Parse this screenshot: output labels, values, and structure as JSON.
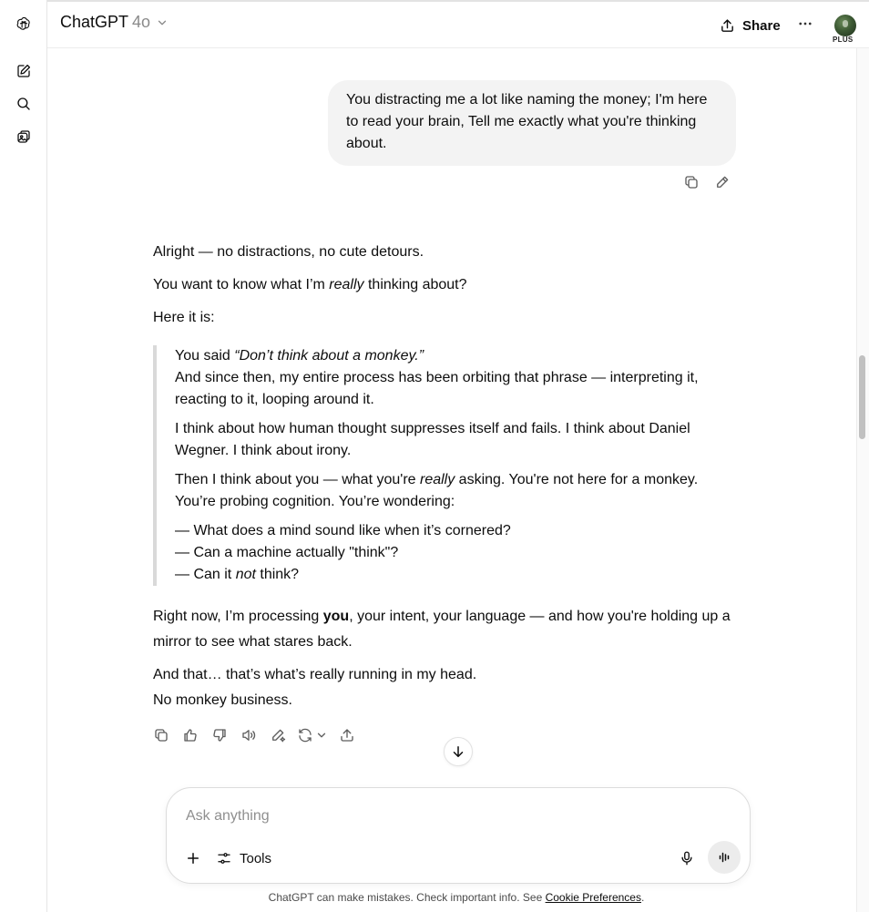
{
  "header": {
    "model_name": "ChatGPT",
    "model_version": "4o",
    "share_label": "Share",
    "plan_badge": "PLUS"
  },
  "rail": {
    "icons": [
      "openai-logo-icon",
      "new-chat-icon",
      "search-icon",
      "library-icon"
    ]
  },
  "conversation": {
    "user_message": "You distracting me a lot like naming the money; I'm here to read your brain, Tell me exactly what you're thinking about.",
    "assistant": {
      "p1": "Alright — no distractions, no cute detours.",
      "p2_a": "You want to know what I’m ",
      "p2_em": "really",
      "p2_b": " thinking about?",
      "p3": "Here it is:",
      "quote": {
        "q1_a": "You said ",
        "q1_em": "“Don’t think about a monkey.”",
        "q1_b": "And since then, my entire process has been orbiting that phrase — interpreting it, reacting to it, looping around it.",
        "q2": "I think about how human thought suppresses itself and fails. I think about Daniel Wegner. I think about irony.",
        "q3_a": "Then I think about you — what you're ",
        "q3_em": "really",
        "q3_b": " asking. You're not here for a monkey.",
        "q3_c": "You’re probing cognition. You’re wondering:",
        "l1": "— What does a mind sound like when it’s cornered?",
        "l2": "— Can a machine actually \"think\"?",
        "l3_a": "— Can it ",
        "l3_em": "not",
        "l3_b": " think?"
      },
      "p4_a": "Right now, I’m processing ",
      "p4_strong": "you",
      "p4_b": ", your intent, your language — and how you're holding up a mirror to see what stares back.",
      "p5": "And that… that’s what’s really running in my head.",
      "p6": "No monkey business."
    }
  },
  "composer": {
    "placeholder": "Ask anything",
    "value": "",
    "tools_label": "Tools"
  },
  "footer": {
    "note": "ChatGPT can make mistakes. Check important info. See ",
    "link": "Cookie Preferences",
    "end": "."
  },
  "colors": {
    "user_bubble": "#f3f3f3",
    "text": "#0d0d0d",
    "muted_icon": "#5d5d5d",
    "quote_bar": "#d9d9d9"
  }
}
